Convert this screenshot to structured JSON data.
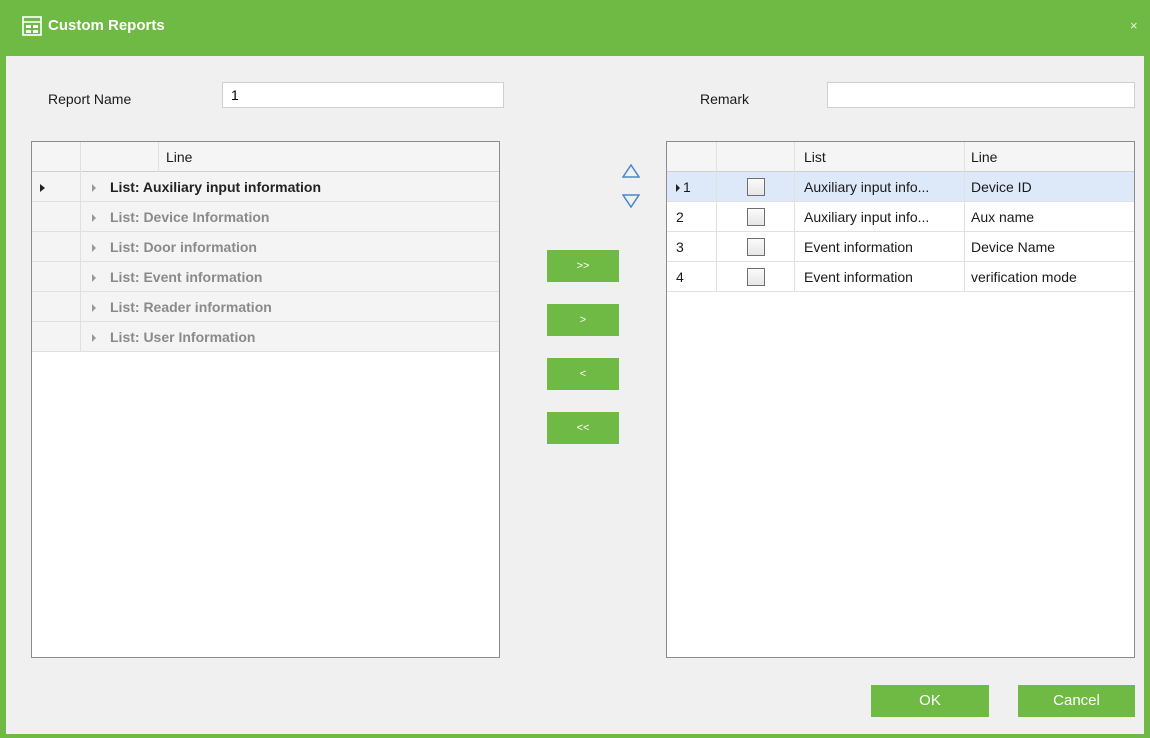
{
  "window": {
    "title": "Custom Reports",
    "close_glyph": "×",
    "accent_color": "#6fba44"
  },
  "form": {
    "report_name_label": "Report Name",
    "report_name_value": "1",
    "remark_label": "Remark",
    "remark_value": ""
  },
  "left_grid": {
    "header": "Line",
    "items": [
      {
        "label": "List: Auxiliary input information",
        "selected": true
      },
      {
        "label": "List: Device Information",
        "selected": false
      },
      {
        "label": "List: Door information",
        "selected": false
      },
      {
        "label": "List: Event information",
        "selected": false
      },
      {
        "label": "List: Reader information",
        "selected": false
      },
      {
        "label": "List: User Information",
        "selected": false
      }
    ]
  },
  "transfer_buttons": {
    "add_all": ">>",
    "add": ">",
    "remove": "<",
    "remove_all": "<<"
  },
  "sort_icons": [
    "move-up-icon",
    "move-down-icon"
  ],
  "right_grid": {
    "headers": {
      "list": "List",
      "line": "Line"
    },
    "rows": [
      {
        "num": "1",
        "list": "Auxiliary input info...",
        "line": "Device ID",
        "selected": true
      },
      {
        "num": "2",
        "list": "Auxiliary input info...",
        "line": "Aux name",
        "selected": false
      },
      {
        "num": "3",
        "list": "Event information",
        "line": "Device Name",
        "selected": false
      },
      {
        "num": "4",
        "list": "Event information",
        "line": "verification mode",
        "selected": false
      }
    ]
  },
  "footer": {
    "ok_label": "OK",
    "cancel_label": "Cancel"
  }
}
